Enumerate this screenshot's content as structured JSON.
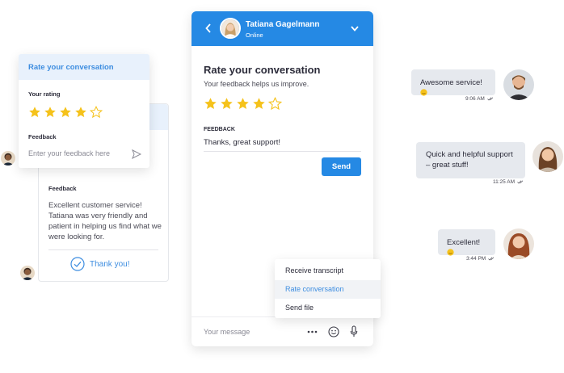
{
  "left_card": {
    "feedback_label": "Feedback",
    "feedback_text": "Excellent customer service! Tatiana was very friendly and patient in helping us find what we were looking for.",
    "thanks": "Thank you!"
  },
  "rate_popup": {
    "title": "Rate your conversation",
    "rating_label": "Your rating",
    "rating": 4,
    "max_rating": 5,
    "feedback_label": "Feedback",
    "feedback_placeholder": "Enter your feedback here"
  },
  "chat": {
    "agent_name": "Tatiana Gagelmann",
    "agent_status": "Online",
    "title": "Rate your conversation",
    "subtitle": "Your feedback helps us improve.",
    "rating": 4,
    "max_rating": 5,
    "feedback_label": "FEEDBACK",
    "feedback_value": "Thanks, great support!",
    "send_label": "Send",
    "message_placeholder": "Your message"
  },
  "menu": {
    "items": [
      {
        "label": "Receive transcript",
        "active": false
      },
      {
        "label": "Rate conversation",
        "active": true
      },
      {
        "label": "Send file",
        "active": false
      }
    ]
  },
  "messages": [
    {
      "text": "Awesome service!",
      "time": "9:06 AM"
    },
    {
      "text": "Quick and helpful support – great stuff!",
      "time": "11:25 AM"
    },
    {
      "text": "Excellent!",
      "time": "3:44 PM"
    }
  ],
  "colors": {
    "accent": "#2589e4",
    "star": "#f5c21b",
    "bubble": "#e6e9ee"
  }
}
